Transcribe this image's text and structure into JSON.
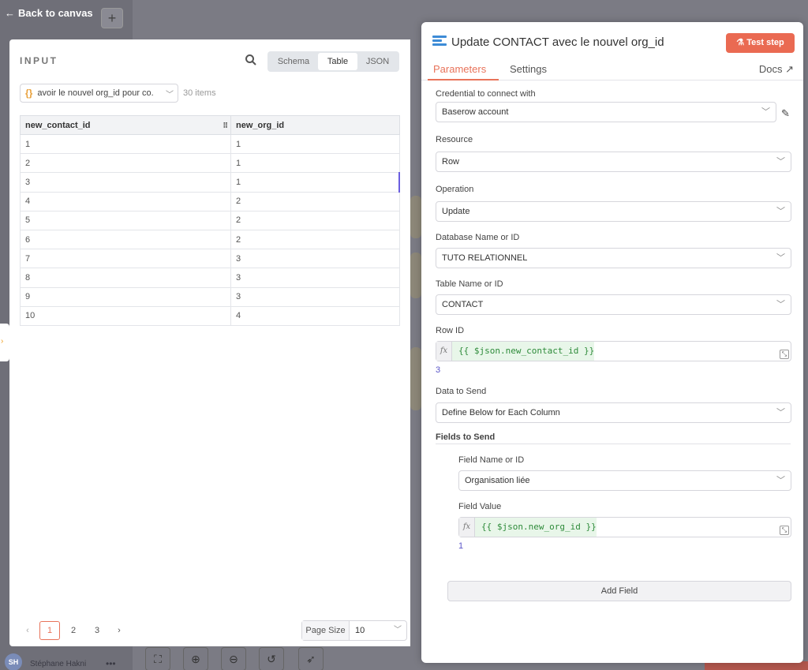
{
  "canvas": {
    "back_label": "Back to canvas",
    "user_initials": "SH",
    "user_name": "Stéphane Hakni",
    "user_more": "•••",
    "zoom_controls": [
      "fit-view-icon",
      "zoom-in-icon",
      "zoom-out-icon",
      "undo-icon",
      "clean-up-icon"
    ]
  },
  "input": {
    "title": "INPUT",
    "views": [
      "Schema",
      "Table",
      "JSON"
    ],
    "active_view": "Table",
    "node_select": "avoir le nouvel org_id pour co.",
    "items_count": "30 items",
    "columns": [
      "new_contact_id",
      "new_org_id"
    ],
    "rows": [
      [
        "1",
        "1"
      ],
      [
        "2",
        "1"
      ],
      [
        "3",
        "1"
      ],
      [
        "4",
        "2"
      ],
      [
        "5",
        "2"
      ],
      [
        "6",
        "2"
      ],
      [
        "7",
        "3"
      ],
      [
        "8",
        "3"
      ],
      [
        "9",
        "3"
      ],
      [
        "10",
        "4"
      ]
    ],
    "selected_row": 2,
    "pages": [
      "1",
      "2",
      "3"
    ],
    "current_page": "1",
    "page_size_label": "Page Size",
    "page_size_value": "10"
  },
  "node": {
    "title": "Update CONTACT avec le nouvel org_id",
    "test_button": "Test step",
    "tabs": [
      "Parameters",
      "Settings"
    ],
    "active_tab": "Parameters",
    "docs_label": "Docs",
    "accent_color": "#ea6a52",
    "params": {
      "credential_label": "Credential to connect with",
      "credential_value": "Baserow account",
      "resource_label": "Resource",
      "resource_value": "Row",
      "operation_label": "Operation",
      "operation_value": "Update",
      "database_label": "Database Name or ID",
      "database_value": "TUTO RELATIONNEL",
      "table_label": "Table Name or ID",
      "table_value": "CONTACT",
      "rowid_label": "Row ID",
      "rowid_expr": "{{ $json.new_contact_id }}",
      "rowid_result": "3",
      "data_label": "Data to Send",
      "data_value": "Define Below for Each Column",
      "fields_header": "Fields to Send",
      "field_name_label": "Field Name or ID",
      "field_name_value": "Organisation liée",
      "field_value_label": "Field Value",
      "field_value_expr": "{{ $json.new_org_id }}",
      "field_value_result": "1",
      "add_field": "Add Field"
    }
  }
}
